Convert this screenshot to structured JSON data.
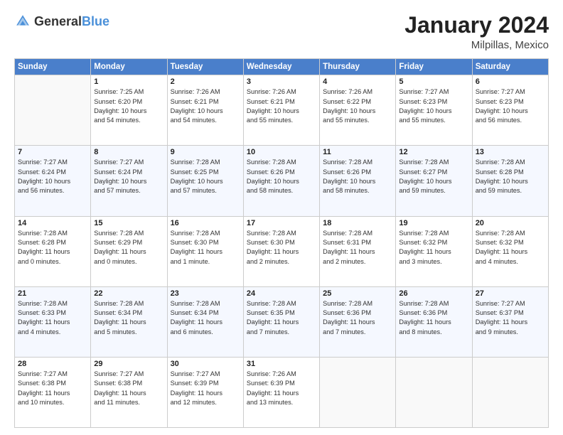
{
  "header": {
    "logo_general": "General",
    "logo_blue": "Blue",
    "month_title": "January 2024",
    "location": "Milpillas, Mexico"
  },
  "days_of_week": [
    "Sunday",
    "Monday",
    "Tuesday",
    "Wednesday",
    "Thursday",
    "Friday",
    "Saturday"
  ],
  "weeks": [
    [
      {
        "day": "",
        "content": ""
      },
      {
        "day": "1",
        "content": "Sunrise: 7:25 AM\nSunset: 6:20 PM\nDaylight: 10 hours\nand 54 minutes."
      },
      {
        "day": "2",
        "content": "Sunrise: 7:26 AM\nSunset: 6:21 PM\nDaylight: 10 hours\nand 54 minutes."
      },
      {
        "day": "3",
        "content": "Sunrise: 7:26 AM\nSunset: 6:21 PM\nDaylight: 10 hours\nand 55 minutes."
      },
      {
        "day": "4",
        "content": "Sunrise: 7:26 AM\nSunset: 6:22 PM\nDaylight: 10 hours\nand 55 minutes."
      },
      {
        "day": "5",
        "content": "Sunrise: 7:27 AM\nSunset: 6:23 PM\nDaylight: 10 hours\nand 55 minutes."
      },
      {
        "day": "6",
        "content": "Sunrise: 7:27 AM\nSunset: 6:23 PM\nDaylight: 10 hours\nand 56 minutes."
      }
    ],
    [
      {
        "day": "7",
        "content": "Sunrise: 7:27 AM\nSunset: 6:24 PM\nDaylight: 10 hours\nand 56 minutes."
      },
      {
        "day": "8",
        "content": "Sunrise: 7:27 AM\nSunset: 6:24 PM\nDaylight: 10 hours\nand 57 minutes."
      },
      {
        "day": "9",
        "content": "Sunrise: 7:28 AM\nSunset: 6:25 PM\nDaylight: 10 hours\nand 57 minutes."
      },
      {
        "day": "10",
        "content": "Sunrise: 7:28 AM\nSunset: 6:26 PM\nDaylight: 10 hours\nand 58 minutes."
      },
      {
        "day": "11",
        "content": "Sunrise: 7:28 AM\nSunset: 6:26 PM\nDaylight: 10 hours\nand 58 minutes."
      },
      {
        "day": "12",
        "content": "Sunrise: 7:28 AM\nSunset: 6:27 PM\nDaylight: 10 hours\nand 59 minutes."
      },
      {
        "day": "13",
        "content": "Sunrise: 7:28 AM\nSunset: 6:28 PM\nDaylight: 10 hours\nand 59 minutes."
      }
    ],
    [
      {
        "day": "14",
        "content": "Sunrise: 7:28 AM\nSunset: 6:28 PM\nDaylight: 11 hours\nand 0 minutes."
      },
      {
        "day": "15",
        "content": "Sunrise: 7:28 AM\nSunset: 6:29 PM\nDaylight: 11 hours\nand 0 minutes."
      },
      {
        "day": "16",
        "content": "Sunrise: 7:28 AM\nSunset: 6:30 PM\nDaylight: 11 hours\nand 1 minute."
      },
      {
        "day": "17",
        "content": "Sunrise: 7:28 AM\nSunset: 6:30 PM\nDaylight: 11 hours\nand 2 minutes."
      },
      {
        "day": "18",
        "content": "Sunrise: 7:28 AM\nSunset: 6:31 PM\nDaylight: 11 hours\nand 2 minutes."
      },
      {
        "day": "19",
        "content": "Sunrise: 7:28 AM\nSunset: 6:32 PM\nDaylight: 11 hours\nand 3 minutes."
      },
      {
        "day": "20",
        "content": "Sunrise: 7:28 AM\nSunset: 6:32 PM\nDaylight: 11 hours\nand 4 minutes."
      }
    ],
    [
      {
        "day": "21",
        "content": "Sunrise: 7:28 AM\nSunset: 6:33 PM\nDaylight: 11 hours\nand 4 minutes."
      },
      {
        "day": "22",
        "content": "Sunrise: 7:28 AM\nSunset: 6:34 PM\nDaylight: 11 hours\nand 5 minutes."
      },
      {
        "day": "23",
        "content": "Sunrise: 7:28 AM\nSunset: 6:34 PM\nDaylight: 11 hours\nand 6 minutes."
      },
      {
        "day": "24",
        "content": "Sunrise: 7:28 AM\nSunset: 6:35 PM\nDaylight: 11 hours\nand 7 minutes."
      },
      {
        "day": "25",
        "content": "Sunrise: 7:28 AM\nSunset: 6:36 PM\nDaylight: 11 hours\nand 7 minutes."
      },
      {
        "day": "26",
        "content": "Sunrise: 7:28 AM\nSunset: 6:36 PM\nDaylight: 11 hours\nand 8 minutes."
      },
      {
        "day": "27",
        "content": "Sunrise: 7:27 AM\nSunset: 6:37 PM\nDaylight: 11 hours\nand 9 minutes."
      }
    ],
    [
      {
        "day": "28",
        "content": "Sunrise: 7:27 AM\nSunset: 6:38 PM\nDaylight: 11 hours\nand 10 minutes."
      },
      {
        "day": "29",
        "content": "Sunrise: 7:27 AM\nSunset: 6:38 PM\nDaylight: 11 hours\nand 11 minutes."
      },
      {
        "day": "30",
        "content": "Sunrise: 7:27 AM\nSunset: 6:39 PM\nDaylight: 11 hours\nand 12 minutes."
      },
      {
        "day": "31",
        "content": "Sunrise: 7:26 AM\nSunset: 6:39 PM\nDaylight: 11 hours\nand 13 minutes."
      },
      {
        "day": "",
        "content": ""
      },
      {
        "day": "",
        "content": ""
      },
      {
        "day": "",
        "content": ""
      }
    ]
  ]
}
